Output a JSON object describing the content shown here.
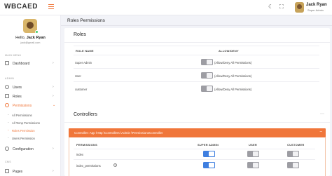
{
  "topbar": {
    "logo": "WBCAED",
    "user_name": "Jack Ryan",
    "user_role": "Super Admin"
  },
  "sidebar": {
    "greeting": "Hello,",
    "user_name": "Jack Ryan",
    "email": "jack@gmail.com",
    "main_menu_label": "MAIN MENU",
    "admin_label": "ADMIN",
    "cms_label": "CMS",
    "items": {
      "dashboard": "Dashboard",
      "users": "Users",
      "roles": "Roles",
      "permissions": "Permissions",
      "configuration": "Configuration",
      "pages": "Pages"
    },
    "sub_items": {
      "all_permissions": "All Permissions",
      "all_temp_permissions": "All Temp Permissions",
      "roles_permissions": "Roles Permission",
      "users_permissions": "Users Permission"
    }
  },
  "main": {
    "page_title": "Roles Permissions",
    "roles_card": {
      "title": "Roles",
      "col_role": "ROLE NAME",
      "col_allow": "ALLOW/DENY",
      "rows": [
        {
          "name": "Super Admin",
          "status": "(Allow/Deny All Permissions)"
        },
        {
          "name": "User",
          "status": "(Allow/Deny All Permissions)"
        },
        {
          "name": "customer",
          "status": "(Allow/Deny All Permissions)"
        }
      ]
    },
    "controllers_card": {
      "title": "Controllers",
      "controller_path": "Controller: App \\Http \\Controllers \\Admin \\PermissionsController",
      "col_permissions": "PERMISSIONS",
      "col_super_admin": "SUPER ADMIN",
      "col_user": "USER",
      "col_customer": "CUSTOMER",
      "rows": [
        {
          "name": "index"
        },
        {
          "name": "index_permissions"
        }
      ]
    }
  }
}
